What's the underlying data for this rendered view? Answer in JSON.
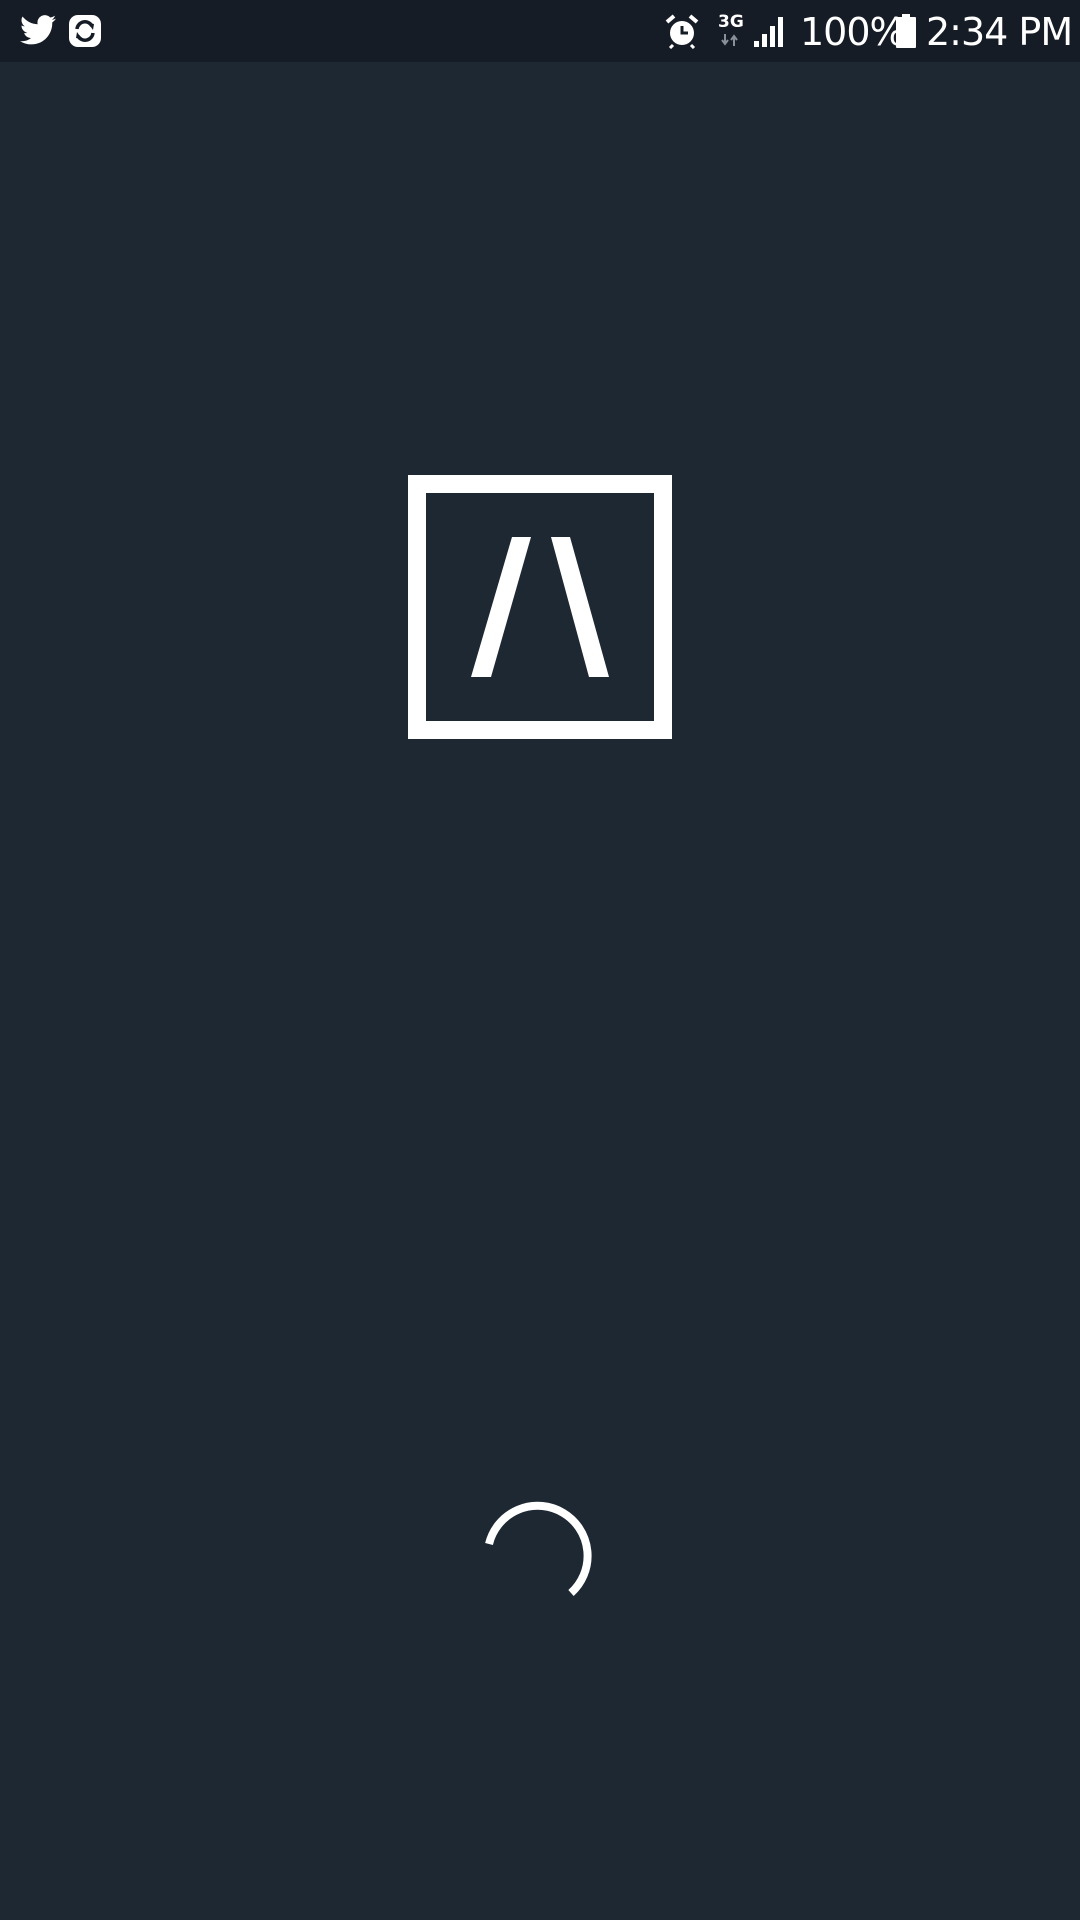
{
  "status_bar": {
    "left_icons": [
      "twitter-icon",
      "sync-icon"
    ],
    "right_icons": [
      "alarm-icon",
      "signal-icon",
      "battery-icon"
    ],
    "network_type": "3G",
    "battery_percent": "100%",
    "time": "2:34 PM"
  },
  "splash": {
    "logo": "app-logo",
    "loading_indicator": "spinner"
  },
  "colors": {
    "background": "#1e2833",
    "status_bar": "#161c26",
    "foreground": "#ffffff"
  }
}
